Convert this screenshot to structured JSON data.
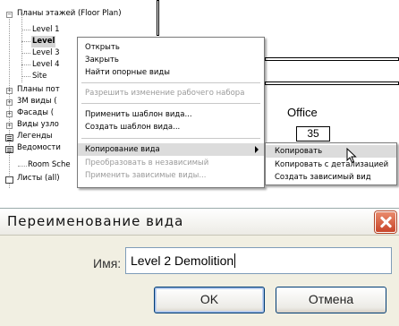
{
  "tree": {
    "rows": [
      {
        "label": "Планы этажей (Floor Plan)",
        "expander": "−"
      },
      {
        "label": "Level 1"
      },
      {
        "label": "Level",
        "selected": true
      },
      {
        "label": "Level 3"
      },
      {
        "label": "Level 4"
      },
      {
        "label": "Site"
      },
      {
        "label": "Планы пот",
        "expander": "+"
      },
      {
        "label": "3M виды (",
        "expander": "+"
      },
      {
        "label": "Фасады (",
        "expander": "+"
      },
      {
        "label": "Виды узло",
        "expander": "+"
      },
      {
        "label": "Легенды"
      },
      {
        "label": "Ведомости"
      },
      {
        "label": "Room Sche"
      },
      {
        "label": "Листы (all)"
      }
    ]
  },
  "canvas": {
    "room_name": "Office",
    "room_number": "35"
  },
  "context_menu": {
    "items": [
      {
        "label": "Открыть",
        "disabled": false
      },
      {
        "label": "Закрыть",
        "disabled": false
      },
      {
        "label": "Найти опорные виды",
        "disabled": false
      },
      {
        "label": "Разрешить изменение рабочего набора",
        "disabled": true
      },
      {
        "label": "Применить шаблон вида...",
        "disabled": false
      },
      {
        "label": "Создать шаблон вида...",
        "disabled": false
      },
      {
        "label": "Копирование вида",
        "disabled": false,
        "submenu": true,
        "highlighted": true
      },
      {
        "label": "Преобразовать в независимый",
        "disabled": true
      },
      {
        "label": "Применить зависимые виды...",
        "disabled": true
      }
    ]
  },
  "submenu": {
    "items": [
      {
        "label": "Копировать",
        "highlighted": true
      },
      {
        "label": "Копировать с детализацией"
      },
      {
        "label": "Создать зависимый вид"
      }
    ]
  },
  "dialog": {
    "title": "Переименование вида",
    "name_label": "Имя:",
    "name_value": "Level 2 Demolition",
    "ok_label": "OK",
    "cancel_label": "Отмена"
  },
  "colors": {
    "dialog_bg": "#f1efe2",
    "close_button": "#c8452a",
    "button_border": "#003c74",
    "input_border": "#7f9db9"
  }
}
